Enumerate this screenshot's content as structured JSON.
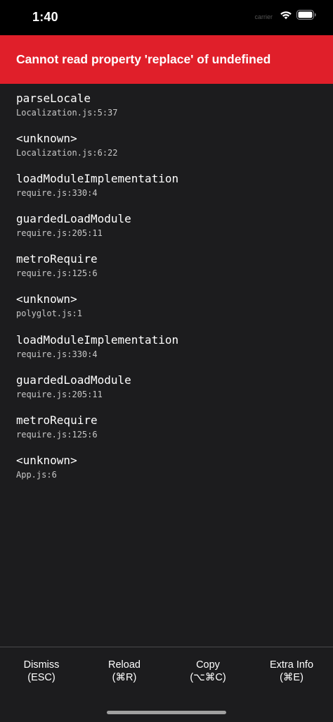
{
  "status_bar": {
    "time": "1:40",
    "carrier": "carrier",
    "icons": [
      "wifi-icon",
      "battery-icon"
    ]
  },
  "error": {
    "message": "Cannot read property 'replace' of undefined",
    "color": "#e01f2a"
  },
  "stack": [
    {
      "method": "parseLocale",
      "location": "Localization.js:5:37"
    },
    {
      "method": "<unknown>",
      "location": "Localization.js:6:22"
    },
    {
      "method": "loadModuleImplementation",
      "location": "require.js:330:4"
    },
    {
      "method": "guardedLoadModule",
      "location": "require.js:205:11"
    },
    {
      "method": "metroRequire",
      "location": "require.js:125:6"
    },
    {
      "method": "<unknown>",
      "location": "polyglot.js:1"
    },
    {
      "method": "loadModuleImplementation",
      "location": "require.js:330:4"
    },
    {
      "method": "guardedLoadModule",
      "location": "require.js:205:11"
    },
    {
      "method": "metroRequire",
      "location": "require.js:125:6"
    },
    {
      "method": "<unknown>",
      "location": "App.js:6"
    }
  ],
  "buttons": {
    "dismiss": {
      "label": "Dismiss",
      "shortcut": "(ESC)"
    },
    "reload": {
      "label": "Reload",
      "shortcut": "(⌘R)"
    },
    "copy": {
      "label": "Copy",
      "shortcut": "(⌥⌘C)"
    },
    "extra_info": {
      "label": "Extra Info",
      "shortcut": "(⌘E)"
    }
  }
}
